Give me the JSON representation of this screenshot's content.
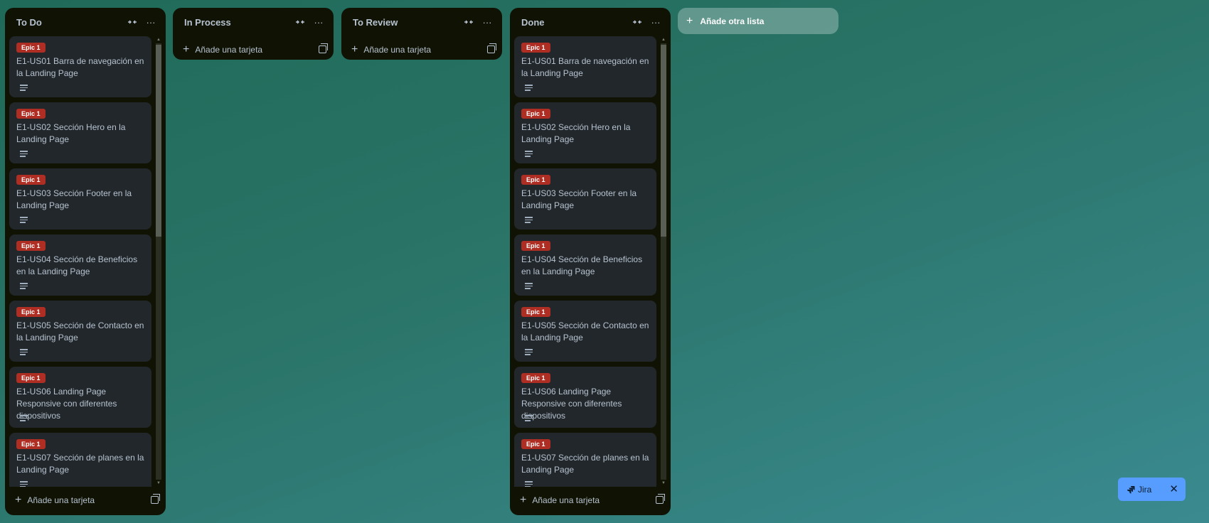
{
  "board": {
    "lists": [
      {
        "title": "To Do",
        "add_card_label": "Añade una tarjeta",
        "cards": [
          {
            "badge": "Epic 1",
            "title": "E1-US01 Barra de navegación en la Landing Page"
          },
          {
            "badge": "Epic 1",
            "title": "E1-US02 Sección Hero en la Landing Page"
          },
          {
            "badge": "Epic 1",
            "title": "E1-US03 Sección Footer en la Landing Page"
          },
          {
            "badge": "Epic 1",
            "title": "E1-US04 Sección de Beneficios en la Landing Page"
          },
          {
            "badge": "Epic 1",
            "title": "E1-US05 Sección de Contacto en la Landing Page"
          },
          {
            "badge": "Epic 1",
            "title": "E1-US06 Landing Page Responsive con diferentes dispositivos"
          },
          {
            "badge": "Epic 1",
            "title": "E1-US07 Sección de planes en la Landing Page"
          }
        ]
      },
      {
        "title": "In Process",
        "add_card_label": "Añade una tarjeta",
        "cards": []
      },
      {
        "title": "To Review",
        "add_card_label": "Añade una tarjeta",
        "cards": []
      },
      {
        "title": "Done",
        "add_card_label": "Añade una tarjeta",
        "cards": [
          {
            "badge": "Epic 1",
            "title": "E1-US01 Barra de navegación en la Landing Page"
          },
          {
            "badge": "Epic 1",
            "title": "E1-US02 Sección Hero en la Landing Page"
          },
          {
            "badge": "Epic 1",
            "title": "E1-US03 Sección Footer en la Landing Page"
          },
          {
            "badge": "Epic 1",
            "title": "E1-US04 Sección de Beneficios en la Landing Page"
          },
          {
            "badge": "Epic 1",
            "title": "E1-US05 Sección de Contacto en la Landing Page"
          },
          {
            "badge": "Epic 1",
            "title": "E1-US06 Landing Page Responsive con diferentes dispositivos"
          },
          {
            "badge": "Epic 1",
            "title": "E1-US07 Sección de planes en la Landing Page"
          }
        ]
      }
    ],
    "add_list_label": "Añade otra lista"
  },
  "icons": {
    "collapse": "collapse-list-icon",
    "more": "more-options-icon",
    "plus": "plus-icon",
    "template": "card-template-icon",
    "description": "description-icon",
    "jira": "jira-logo-icon",
    "close": "close-icon"
  },
  "jira_widget": {
    "label": "Jira",
    "close": "✕"
  },
  "colors": {
    "list_bg": "#101204",
    "card_bg": "#22272b",
    "badge": "#ae2e24",
    "jira": "#579dff"
  }
}
